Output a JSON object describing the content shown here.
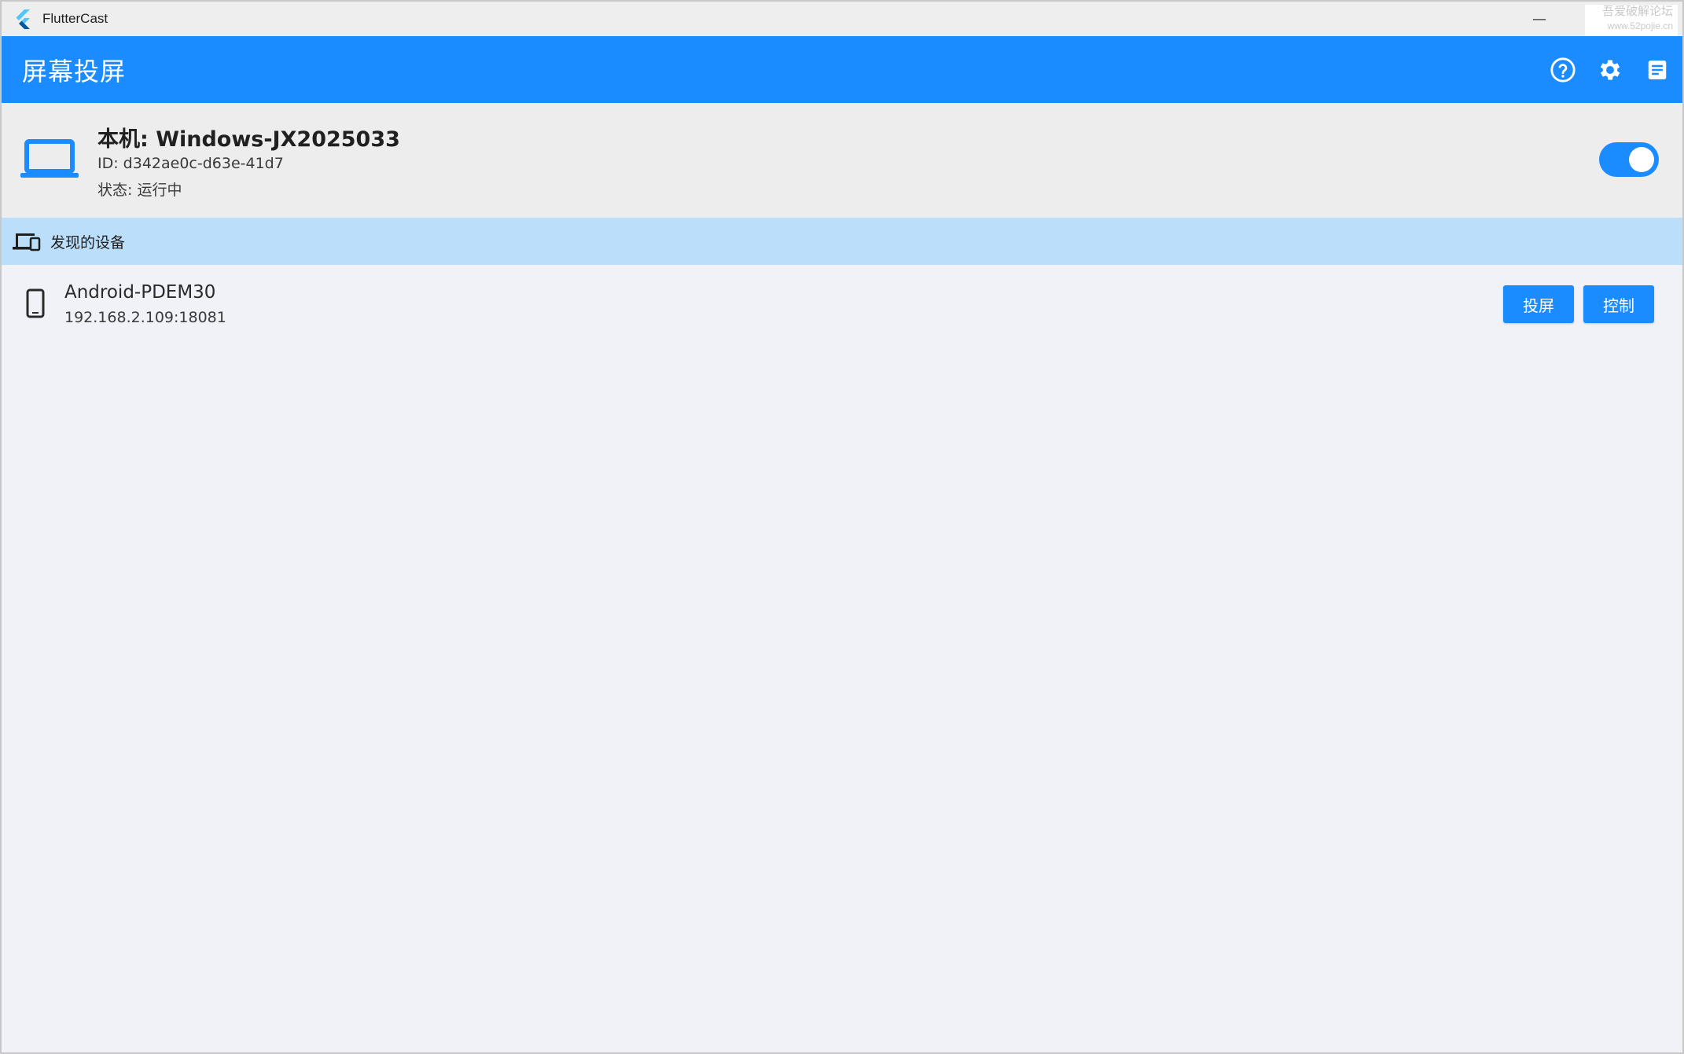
{
  "window": {
    "app_name": "FlutterCast",
    "minimize_symbol": "—",
    "watermark_line1": "吾爱破解论坛",
    "watermark_line2": "www.52pojie.cn"
  },
  "appbar": {
    "title": "屏幕投屏",
    "actions": [
      {
        "icon": "help-circle-icon"
      },
      {
        "icon": "gear-icon"
      },
      {
        "icon": "log-document-icon"
      }
    ]
  },
  "host": {
    "icon": "laptop-icon",
    "name": "本机: Windows-JX2025033",
    "id_text": "ID: d342ae0c-d63e-41d7",
    "status_text": "状态: 运行中",
    "service_enabled": true
  },
  "discovered": {
    "icon": "devices-icon",
    "label": "发现的设备",
    "devices": [
      {
        "icon": "phone-icon",
        "name": "Android-PDEM30",
        "address": "192.168.2.109:18081",
        "cast_label": "投屏",
        "control_label": "控制"
      }
    ]
  },
  "colors": {
    "primary": "#1a8cff",
    "section_bg": "#bbdefb",
    "host_bg": "#ededed",
    "page_bg": "#f0f2f7"
  }
}
